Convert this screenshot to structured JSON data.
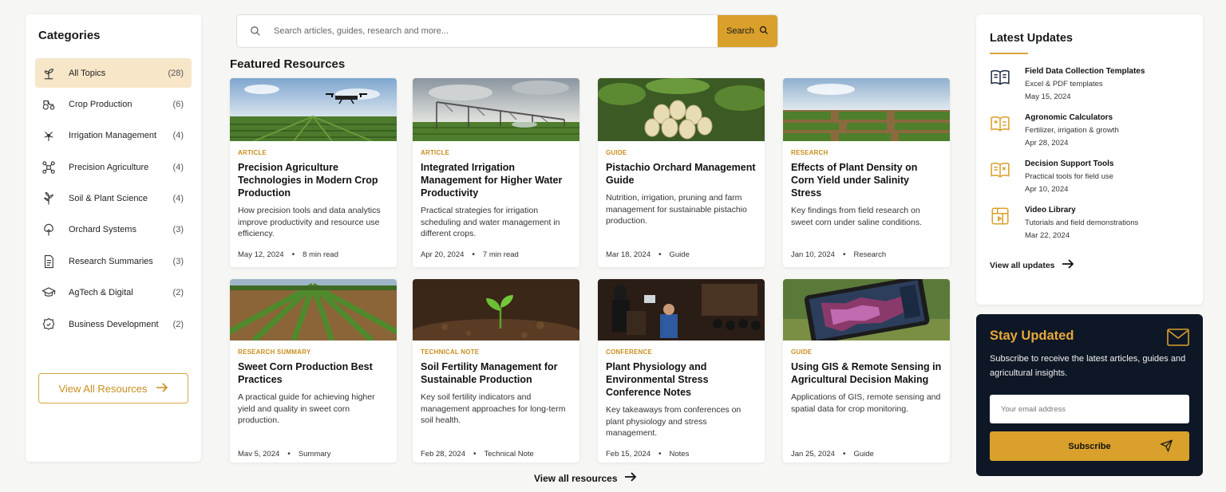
{
  "sidebar": {
    "title": "Categories",
    "items": [
      {
        "label": "All Topics",
        "count": "(28)",
        "icon": "sprout-icon"
      },
      {
        "label": "Crop Production",
        "count": "(6)",
        "icon": "tractor-icon"
      },
      {
        "label": "Irrigation Management",
        "count": "(4)",
        "icon": "sprinkler-icon"
      },
      {
        "label": "Precision Agriculture",
        "count": "(4)",
        "icon": "drone-icon"
      },
      {
        "label": "Soil & Plant Science",
        "count": "(4)",
        "icon": "plant-science-icon"
      },
      {
        "label": "Orchard Systems",
        "count": "(3)",
        "icon": "tree-icon"
      },
      {
        "label": "Research Summaries",
        "count": "(3)",
        "icon": "document-icon"
      },
      {
        "label": "AgTech & Digital",
        "count": "(2)",
        "icon": "graduation-cap-icon"
      },
      {
        "label": "Business Development",
        "count": "(2)",
        "icon": "badge-icon"
      }
    ],
    "view_all_label": "View All Resources"
  },
  "search": {
    "placeholder": "Search articles, guides, research and more...",
    "button_label": "Search"
  },
  "featured": {
    "title": "Featured Resources",
    "cards": [
      {
        "tag": "ARTICLE",
        "title": "Precision Agriculture Technologies in Modern Crop Production",
        "desc": "How precision tools and data analytics improve productivity and resource use efficiency.",
        "date": "May 12, 2024",
        "extra": "8 min read",
        "image": "drone-over-field"
      },
      {
        "tag": "ARTICLE",
        "title": "Integrated Irrigation Management for Higher Water Productivity",
        "desc": "Practical strategies for irrigation scheduling and water management in different crops.",
        "date": "Apr 20, 2024",
        "extra": "7 min read",
        "image": "center-pivot-irrigation"
      },
      {
        "tag": "GUIDE",
        "title": "Pistachio Orchard Management Guide",
        "desc": "Nutrition, irrigation, pruning and farm management for sustainable pistachio production.",
        "date": "Mar 18, 2024",
        "extra": "Guide",
        "image": "pistachio-cluster"
      },
      {
        "tag": "RESEARCH",
        "title": "Effects of Plant Density on Corn Yield under Salinity Stress",
        "desc": "Key findings from field research on sweet corn under saline conditions.",
        "date": "Jan 10, 2024",
        "extra": "Research",
        "image": "corn-field-plots"
      },
      {
        "tag": "RESEARCH SUMMARY",
        "title": "Sweet Corn Production Best Practices",
        "desc": "A practical guide for achieving higher yield and quality in sweet corn production.",
        "date": "Mav 5, 2024",
        "extra": "Summary",
        "image": "young-corn-rows"
      },
      {
        "tag": "TECHNICAL NOTE",
        "title": "Soil Fertility Management for Sustainable Production",
        "desc": "Key soil fertility indicators and management approaches for long-term soil health.",
        "date": "Feb 28, 2024",
        "extra": "Technical Note",
        "image": "seedling-soil"
      },
      {
        "tag": "CONFERENCE",
        "title": "Plant Physiology and Environmental Stress Conference Notes",
        "desc": "Key takeaways from conferences on plant physiology and stress management.",
        "date": "Feb 15, 2024",
        "extra": "Notes",
        "image": "conference-hall"
      },
      {
        "tag": "GUIDE",
        "title": "Using GIS & Remote Sensing in Agricultural Decision Making",
        "desc": "Applications of GIS, remote sensing and spatial data for crop monitoring.",
        "date": "Jan 25, 2024",
        "extra": "Guide",
        "image": "tablet-gis-map"
      }
    ],
    "view_all_label": "View all resources"
  },
  "updates": {
    "title": "Latest Updates",
    "items": [
      {
        "title": "Field Data Collection Templates",
        "subtitle": "Excel & PDF templates",
        "date": "May 15, 2024",
        "icon": "book-icon"
      },
      {
        "title": "Agronomic Calculators",
        "subtitle": "Fertilizer, irrigation & growth",
        "date": "Apr 28, 2024",
        "icon": "calculator-book-icon"
      },
      {
        "title": "Decision Support Tools",
        "subtitle": "Practical tools for field use",
        "date": "Apr 10, 2024",
        "icon": "tools-book-icon"
      },
      {
        "title": "Video Library",
        "subtitle": "Tutorials and field demonstrations",
        "date": "Mar 22, 2024",
        "icon": "video-library-icon"
      }
    ],
    "view_all_label": "View all updates"
  },
  "newsletter": {
    "title": "Stay Updated",
    "text": "Subscribe to receive the latest articles, guides and agricultural insights.",
    "email_placeholder": "Your email address",
    "button_label": "Subscribe"
  },
  "colors": {
    "accent": "#d9a02b",
    "accent_text": "#c98e1f",
    "dark": "#0e1726",
    "active_bg": "#f7e6c8"
  }
}
